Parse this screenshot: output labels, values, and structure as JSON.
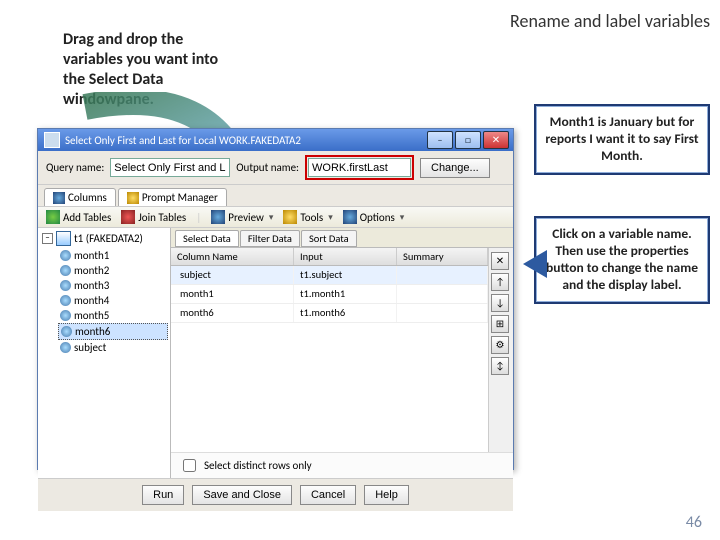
{
  "slide": {
    "title_right": "Rename and label variables",
    "instruction_left": "Drag and drop the variables you want into the Select Data windowpane.",
    "note1": "Month1 is January but for reports I want it to say First Month.",
    "note2": "Click on a variable name. Then use the properties button to change the name and the display label.",
    "page_number": "46"
  },
  "dialog": {
    "title": "Select Only First and Last for Local WORK.FAKEDATA2",
    "labels": {
      "query_name": "Query name:",
      "output_name": "Output name:"
    },
    "fields": {
      "query_name": "Select Only First and Last",
      "output_name": "WORK.firstLast"
    },
    "buttons": {
      "change": "Change...",
      "run": "Run",
      "save": "Save and Close",
      "cancel": "Cancel",
      "help": "Help"
    },
    "tabs": [
      "Columns",
      "Prompt Manager"
    ],
    "toolbar2": {
      "add": "Add Tables",
      "join": "Join Tables",
      "preview": "Preview",
      "tools": "Tools",
      "options": "Options"
    },
    "subtabs": [
      "Select Data",
      "Filter Data",
      "Sort Data"
    ],
    "grid": {
      "headers": [
        "Column Name",
        "Input",
        "Summary"
      ],
      "rows": [
        {
          "col": "subject",
          "input": "t1.subject",
          "sum": ""
        },
        {
          "col": "month1",
          "input": "t1.month1",
          "sum": ""
        },
        {
          "col": "month6",
          "input": "t1.month6",
          "sum": ""
        }
      ]
    },
    "sidebuttons": [
      "✕",
      "↑",
      "↓",
      "⊞",
      "⚙",
      "↕"
    ],
    "tree": {
      "root": "t1 (FAKEDATA2)",
      "items": [
        "month1",
        "month2",
        "month3",
        "month4",
        "month5",
        "month6",
        "subject"
      ],
      "selected": "month6"
    },
    "distinct_label": "Select distinct rows only"
  }
}
